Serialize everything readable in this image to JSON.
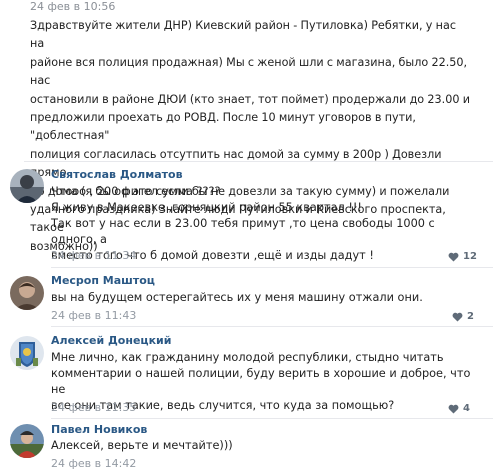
{
  "post": {
    "date": "24 фев в 10:56",
    "text_lines": [
      "Здравствуйте жители ДНР) Киевский район - Путиловка) Ребятки, у нас на",
      "районе вся полиция продажная) Мы с женой шли с магазина, было 22.50, нас",
      "остановили в районе ДЮИ (кто знает, тот поймет) продержали до 23.00 и",
      "предложили проехать до РОВД. После 10 минут уговоров в пути, \"доблестная\"",
      "полиция согласилась отсутпить нас домой за сумму в 200р ) Довезли прямо",
      "до дома (я бы офигел если бы не довезли за такую сумму) и пожелали",
      "удачного праздника) Знайте люди Путиловки и Киевского проспекта, такое",
      "возможно))"
    ]
  },
  "comments": [
    {
      "author": "Святослав Долматов",
      "lines": [
        "Чтооо , 200 р это сумма ????",
        "Я живу в Макеевке ,горняцкий район 55 квартал !!!",
        "Так вот у нас если в 23.00 тебя примут ,то цена свободы 1000 с одного, а",
        "вместо того что б домой довезти ,ещё и   изды дадут !"
      ],
      "date": "24 фев в 11:34",
      "likes": "12"
    },
    {
      "author": "Месроп Маштоц",
      "lines": [
        "вы на будущем остерегайтесь их у меня машину отжали они."
      ],
      "date": "24 фев в 11:43",
      "likes": "2"
    },
    {
      "author": "Алексей Донецкий",
      "lines": [
        "Мне лично, как гражданину молодой республики, стыдно читать",
        "комментарии о нашей полиции, буду верить в хорошие и доброе, что не",
        "все они там такие, ведь случится, что куда за помощью?"
      ],
      "date": "24 фев в 11:35",
      "likes": "4"
    },
    {
      "author": "Павел Новиков",
      "lines": [
        "Алексей, верьте и мечтайте)))"
      ],
      "date": "24 фев в 14:42",
      "likes": ""
    }
  ],
  "icons": {
    "like": "heart-icon"
  },
  "colors": {
    "author": "#2a5885",
    "meta": "#939aa3",
    "divider": "#e7e8ec"
  }
}
